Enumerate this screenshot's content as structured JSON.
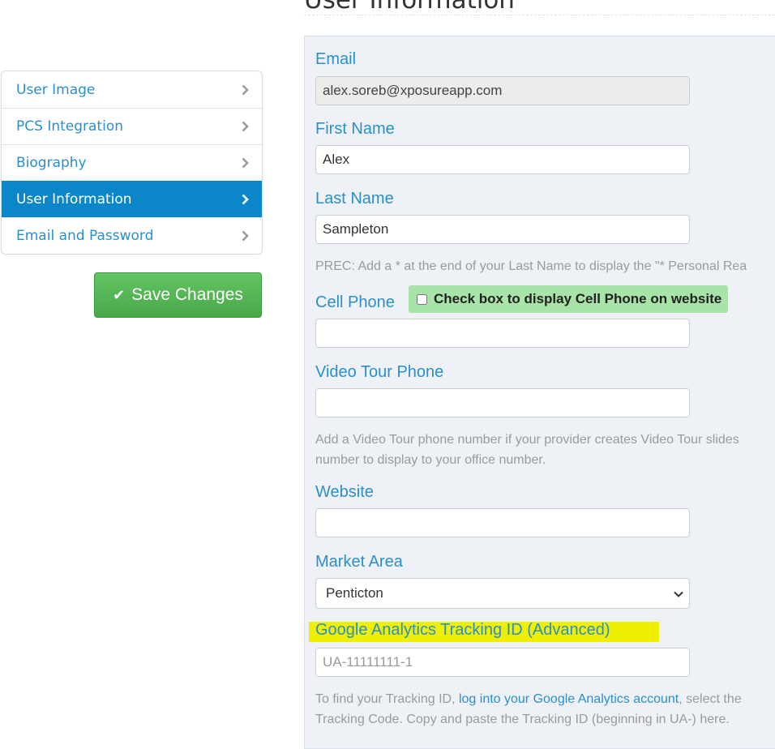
{
  "page": {
    "title": "User Information"
  },
  "sidebar": {
    "items": [
      {
        "label": "User Image"
      },
      {
        "label": "PCS Integration"
      },
      {
        "label": "Biography"
      },
      {
        "label": "User Information",
        "active": true
      },
      {
        "label": "Email and Password"
      }
    ]
  },
  "save_button": {
    "label": "Save Changes",
    "icon": "check-icon"
  },
  "form": {
    "email": {
      "label": "Email",
      "value": "alex.soreb@xposureapp.com"
    },
    "first_name": {
      "label": "First Name",
      "value": "Alex"
    },
    "last_name": {
      "label": "Last Name",
      "value": "Sampleton"
    },
    "prec_help": "PREC: Add a * at the end of your Last Name to display the \"* Personal Rea",
    "cell_phone": {
      "label": "Cell Phone",
      "value": "",
      "display_checkbox_label": "Check box to display Cell Phone on website",
      "checked": false
    },
    "video_tour_phone": {
      "label": "Video Tour Phone",
      "value": ""
    },
    "video_help_line1": "Add a Video Tour phone number if your provider creates Video Tour slides",
    "video_help_line2": "number to display to your office number.",
    "website": {
      "label": "Website",
      "value": ""
    },
    "market_area": {
      "label": "Market Area",
      "selected": "Penticton"
    },
    "ga": {
      "label": "Google Analytics Tracking ID (Advanced)",
      "placeholder": "UA-11111111-1",
      "help_prefix": "To find your Tracking ID, ",
      "help_link": "log into your Google Analytics account",
      "help_suffix": ", select the",
      "help_line2": "Tracking Code. Copy and paste the Tracking ID (beginning in UA-) here."
    }
  },
  "colors": {
    "accent": "#2a8fcc",
    "active_nav": "#0b87c9",
    "save_green": "#5cb85c",
    "checkbox_highlight": "#a8e3a8",
    "ga_highlight": "#eef000",
    "panel_bg": "#eef2f7"
  }
}
